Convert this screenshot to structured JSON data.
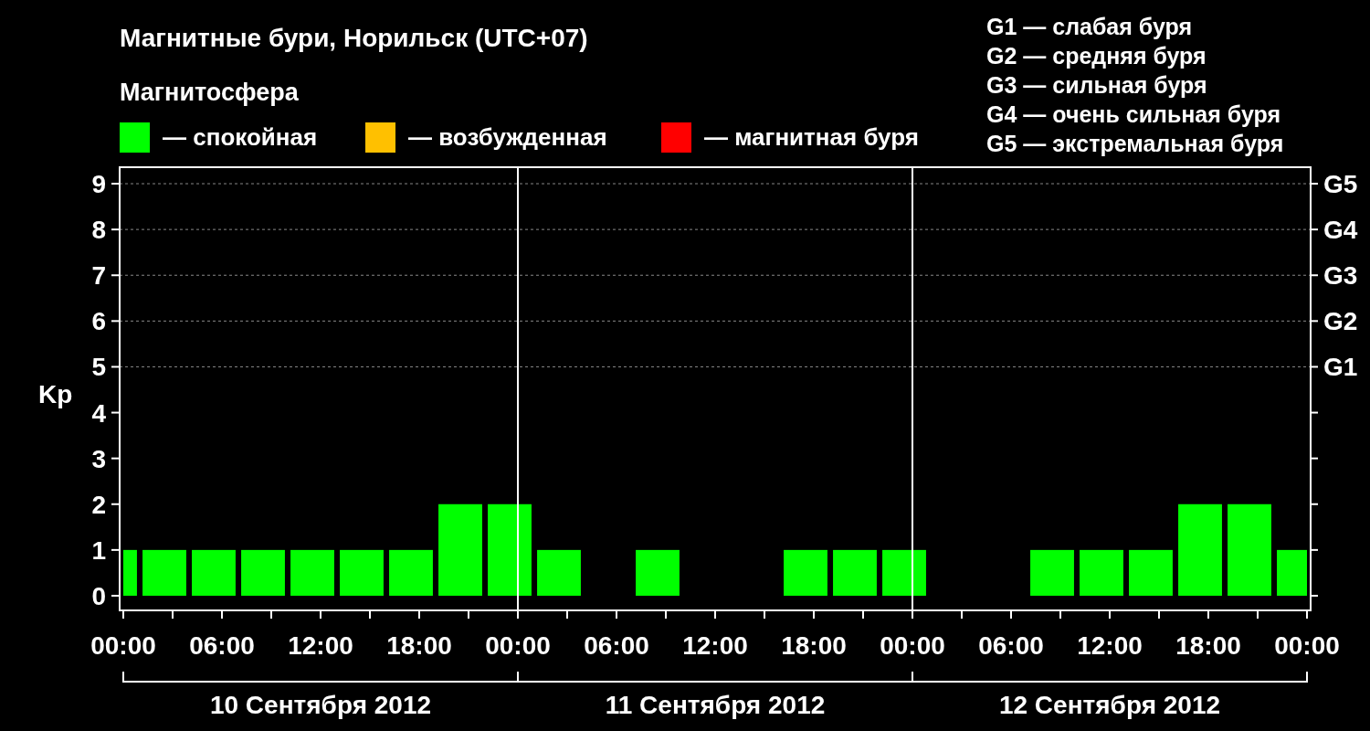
{
  "title": "Магнитные бури, Норильск (UTC+07)",
  "magnetosphere_legend": {
    "heading": "Магнитосфера",
    "items": [
      {
        "label": "— спокойная",
        "color": "#00ff00"
      },
      {
        "label": "— возбужденная",
        "color": "#ffc000"
      },
      {
        "label": "— магнитная буря",
        "color": "#ff0000"
      }
    ]
  },
  "storm_scale_legend": [
    "G1 — слабая буря",
    "G2 — средняя буря",
    "G3 — сильная буря",
    "G4 — очень сильная буря",
    "G5 — экстремальная буря"
  ],
  "chart": {
    "right_axis_labels": [
      "G5",
      "G4",
      "G3",
      "G2",
      "G1"
    ],
    "date_labels": [
      "10 Сентября 2012",
      "11 Сентября 2012",
      "12 Сентября 2012"
    ],
    "chart_data": {
      "type": "bar",
      "ylabel": "Kp",
      "grid": true,
      "x": [
        "2012-09-10T00:25",
        "2012-09-10T02:30",
        "2012-09-10T05:30",
        "2012-09-10T08:30",
        "2012-09-10T11:30",
        "2012-09-10T14:30",
        "2012-09-10T17:30",
        "2012-09-10T20:30",
        "2012-09-10T23:30",
        "2012-09-11T02:30",
        null,
        "2012-09-11T08:30",
        null,
        null,
        "2012-09-11T17:30",
        "2012-09-11T20:30",
        "2012-09-11T23:30",
        null,
        null,
        "2012-09-12T08:30",
        "2012-09-12T11:30",
        "2012-09-12T14:30",
        "2012-09-12T17:30",
        "2012-09-12T20:30",
        "2012-09-12T23:06"
      ],
      "series": [
        {
          "color": "#00ff00",
          "values": [
            1,
            1,
            1,
            1,
            1,
            1,
            1,
            2,
            2,
            1,
            null,
            1,
            null,
            null,
            1,
            1,
            1,
            null,
            null,
            1,
            1,
            1,
            2,
            2,
            1
          ]
        }
      ],
      "xlim": [
        "2012-09-10T00:00",
        "2012-09-13T00:00"
      ],
      "ylim": [
        -0.32,
        9.36
      ],
      "xticks": [
        {
          "value": "2012-09-10T00:00",
          "label": "00:00"
        },
        {
          "value": "2012-09-10T06:00",
          "label": "06:00"
        },
        {
          "value": "2012-09-10T12:00",
          "label": "12:00"
        },
        {
          "value": "2012-09-10T18:00",
          "label": "18:00"
        },
        {
          "value": "2012-09-11T00:00",
          "label": "00:00"
        },
        {
          "value": "2012-09-11T06:00",
          "label": "06:00"
        },
        {
          "value": "2012-09-11T12:00",
          "label": "12:00"
        },
        {
          "value": "2012-09-11T18:00",
          "label": "18:00"
        },
        {
          "value": "2012-09-12T00:00",
          "label": "00:00"
        },
        {
          "value": "2012-09-12T06:00",
          "label": "06:00"
        },
        {
          "value": "2012-09-12T12:00",
          "label": "12:00"
        },
        {
          "value": "2012-09-12T18:00",
          "label": "18:00"
        },
        {
          "value": "2012-09-13T00:00",
          "label": "00:00"
        }
      ],
      "yticks": [
        0,
        1,
        2,
        3,
        4,
        5,
        6,
        7,
        8,
        9
      ]
    }
  }
}
